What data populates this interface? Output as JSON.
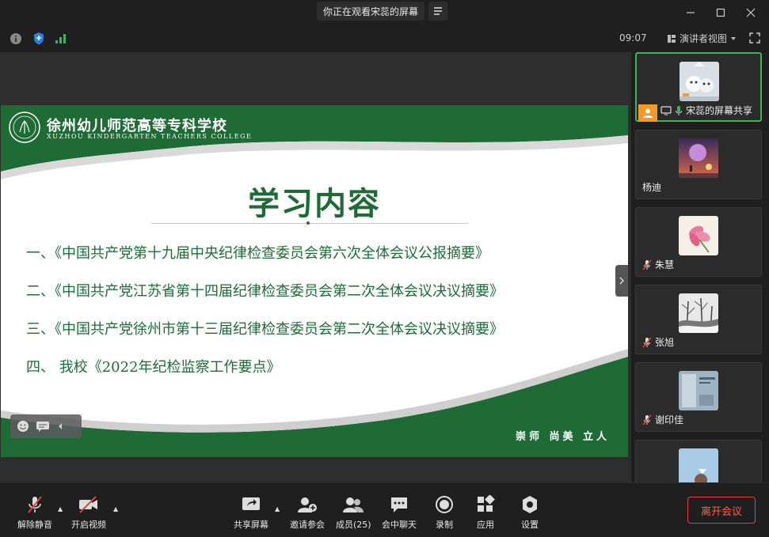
{
  "titlebar": {
    "watching_label": "你正在观看宋蕊的屏幕"
  },
  "infobar": {
    "time": "09:07",
    "view_mode": "演讲者视图"
  },
  "slide": {
    "school_cn": "徐州幼儿师范高等专科学校",
    "school_en": "XUZHOU KINDERGARTEN TEACHERS COLLEGE",
    "title": "学习内容",
    "items": [
      "一、《中国共产党第十九届中央纪律检查委员会第六次全体会议公报摘要》",
      "二、《中国共产党江苏省第十四届纪律检查委员会第二次全体会议决议摘要》",
      "三、《中国共产党徐州市第十三届纪律检查委员会第二次全体会议决议摘要》",
      "四、 我校《2022年纪检监察工作要点》"
    ],
    "motto": "崇师 尚美 立人",
    "colors": {
      "green": "#1f6b36",
      "dark_green": "#17582b"
    }
  },
  "participants": [
    {
      "name": "宋蕊的屏幕共享",
      "thumb": "snow-cartoon",
      "active": true
    },
    {
      "name": "杨迪",
      "thumb": "space-astronaut"
    },
    {
      "name": "朱慧",
      "thumb": "pink-flower"
    },
    {
      "name": "张旭",
      "thumb": "snow-trees"
    },
    {
      "name": "谢印佳",
      "thumb": "book-cover"
    },
    {
      "name": "",
      "thumb": "sky-portrait"
    }
  ],
  "toolbar": {
    "unmute": "解除静音",
    "start_video": "开启视频",
    "share_screen": "共享屏幕",
    "invite": "邀请参会",
    "members": "成员(25)",
    "chat": "会中聊天",
    "record": "录制",
    "apps": "应用",
    "settings": "设置",
    "leave": "离开会议"
  }
}
